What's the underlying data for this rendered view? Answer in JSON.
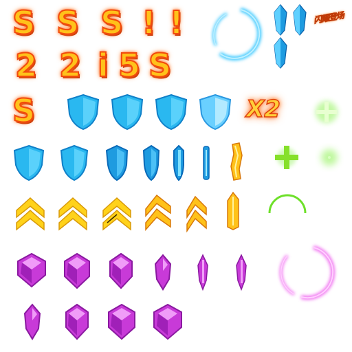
{
  "sheet": {
    "title": "",
    "digit_glyphs": [
      "S",
      "S",
      "S",
      "!",
      "!",
      "2",
      "2",
      "i",
      "5",
      "S",
      "S"
    ],
    "multiplier_label": "X2",
    "logo_text": "闪耀登场"
  },
  "colors": {
    "gold": "#ffc21a",
    "orange_outline": "#f24a0c",
    "blue_shield": "#2ab8f0",
    "purple_gem": "#c83ad8",
    "green_plus": "#7ef03a",
    "ring_blue": "#3ac8ff",
    "ring_pink": "#f070f0"
  },
  "icons": {
    "shields": "shield-icon",
    "chevrons": "rank-chevron-icon",
    "gems": "purple-gem-icon",
    "crystals": "blue-crystal-icon",
    "plus": "green-plus-icon",
    "rings": "glow-ring-icon"
  }
}
